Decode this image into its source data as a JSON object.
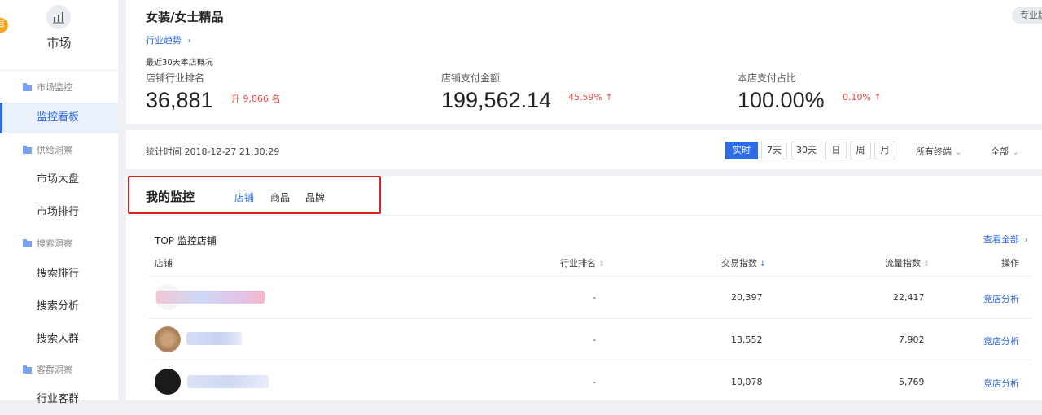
{
  "sidebar": {
    "badge": "目",
    "top_title": "市场",
    "groups": [
      {
        "label": "市场监控",
        "items": [
          "监控看板"
        ]
      },
      {
        "label": "供给洞察",
        "items": [
          "市场大盘",
          "市场排行"
        ]
      },
      {
        "label": "搜索洞察",
        "items": [
          "搜索排行",
          "搜索分析",
          "搜索人群"
        ]
      },
      {
        "label": "客群洞察",
        "items": [
          "行业客群"
        ]
      }
    ]
  },
  "header": {
    "category_title": "女装/女士精品",
    "trend_link": "行业趋势",
    "pro_tag": "专业版",
    "recent_label": "最近30天本店概况"
  },
  "metrics": [
    {
      "label": "店铺行业排名",
      "value": "36,881",
      "change": "升 9,866 名"
    },
    {
      "label": "店铺支付金额",
      "value": "199,562.14",
      "change": "45.59% ↑"
    },
    {
      "label": "本店支付占比",
      "value": "100.00%",
      "change": "0.10% ↑"
    }
  ],
  "filter": {
    "stat_time": "统计时间 2018-12-27 21:30:29",
    "time_buttons": [
      "实时",
      "7天",
      "30天",
      "日",
      "周",
      "月"
    ],
    "active_time": "实时",
    "terminal": "所有终端",
    "scope": "全部"
  },
  "monitor": {
    "title": "我的监控",
    "tabs": [
      "店铺",
      "商品",
      "品牌"
    ],
    "active_tab": "店铺"
  },
  "table": {
    "section_title": "TOP 监控店铺",
    "view_all": "查看全部",
    "headers": {
      "shop": "店铺",
      "rank": "行业排名",
      "trade": "交易指数",
      "traffic": "流量指数",
      "action": "操作"
    },
    "rows": [
      {
        "rank": "-",
        "trade": "20,397",
        "traffic": "22,417",
        "action": "竞店分析"
      },
      {
        "rank": "-",
        "trade": "13,552",
        "traffic": "7,902",
        "action": "竞店分析"
      },
      {
        "rank": "-",
        "trade": "10,078",
        "traffic": "5,769",
        "action": "竞店分析"
      }
    ]
  },
  "colors": {
    "accent": "#2e6be6",
    "up": "#e8453c",
    "highlight_box": "#e02020"
  }
}
